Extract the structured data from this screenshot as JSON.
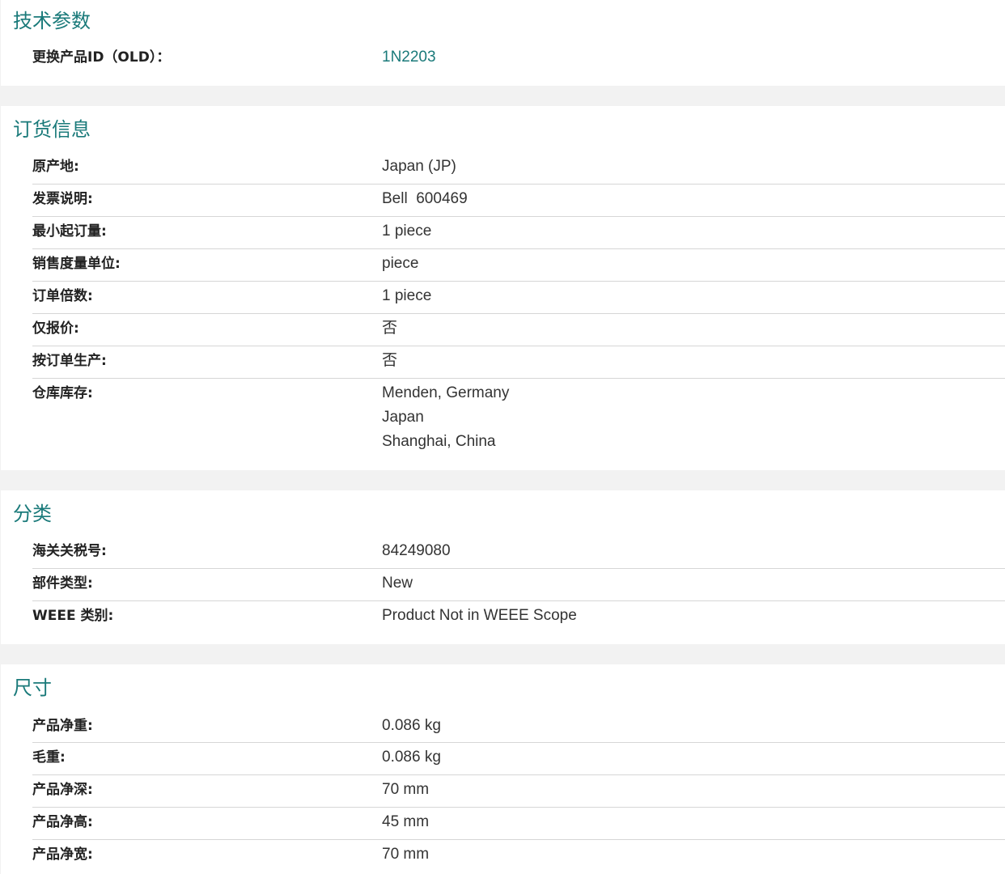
{
  "tech": {
    "title": "技术参数",
    "rows": [
      {
        "label": "更换产品ID（OLD）：",
        "value": "1N2203"
      }
    ]
  },
  "ordering": {
    "title": "订货信息",
    "rows": [
      {
        "label": "原产地:",
        "value": "Japan (JP)"
      },
      {
        "label": "发票说明:",
        "value": "Bell  600469"
      },
      {
        "label": "最小起订量:",
        "value": "1 piece"
      },
      {
        "label": "销售度量单位:",
        "value": "piece"
      },
      {
        "label": "订单倍数:",
        "value": "1 piece"
      },
      {
        "label": "仅报价:",
        "value": "否"
      },
      {
        "label": "按订单生产:",
        "value": "否"
      },
      {
        "label": "仓库库存:",
        "values": [
          "Menden, Germany",
          "Japan",
          "Shanghai, China"
        ]
      }
    ]
  },
  "classification": {
    "title": "分类",
    "rows": [
      {
        "label": "海关关税号:",
        "value": "84249080"
      },
      {
        "label": "部件类型:",
        "value": "New"
      },
      {
        "label": "WEEE 类别:",
        "value": "Product Not in WEEE Scope"
      }
    ]
  },
  "dimensions": {
    "title": "尺寸",
    "rows": [
      {
        "label": "产品净重:",
        "value": "0.086 kg"
      },
      {
        "label": "毛重:",
        "value": "0.086 kg"
      },
      {
        "label": "产品净深:",
        "value": "70 mm"
      },
      {
        "label": "产品净高:",
        "value": "45 mm"
      },
      {
        "label": "产品净宽:",
        "value": "70 mm"
      }
    ]
  }
}
